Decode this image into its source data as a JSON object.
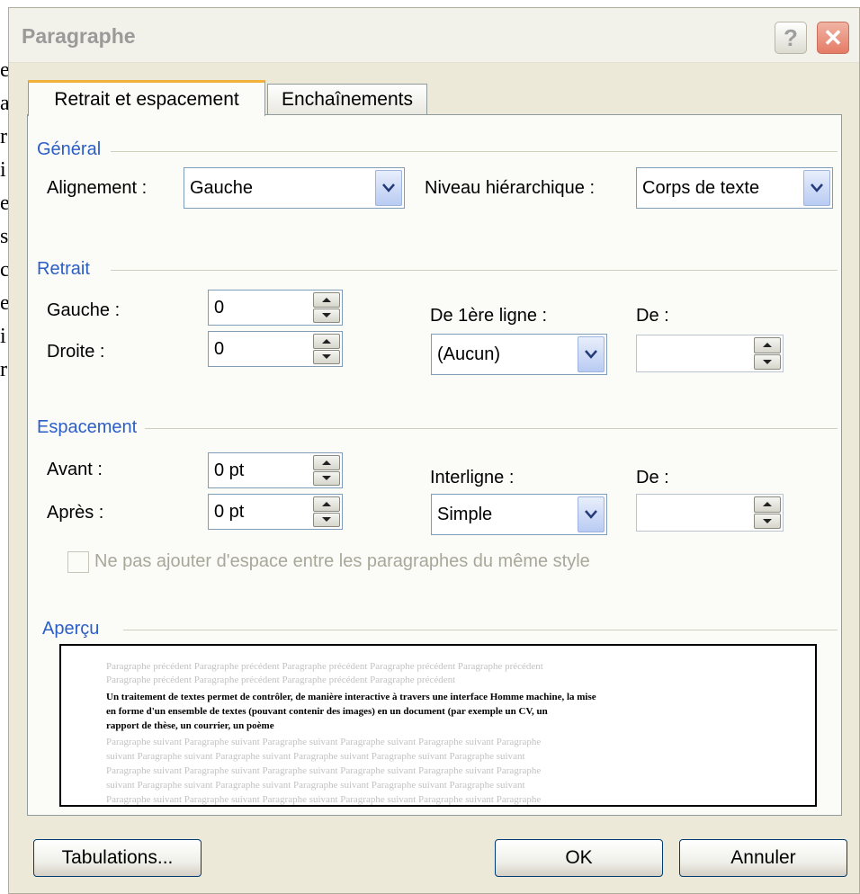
{
  "background_doc": {
    "chars": [
      "e",
      "a",
      "r",
      "i",
      "e",
      "s",
      "c",
      "e",
      "i",
      "r"
    ]
  },
  "title": "Paragraphe",
  "titlebar_buttons": {
    "help": "?",
    "close": "✕"
  },
  "tabs": [
    {
      "label": "Retrait et espacement",
      "active": true
    },
    {
      "label": "Enchaînements",
      "active": false
    }
  ],
  "general": {
    "heading": "Général",
    "alignment_label": "Alignement :",
    "alignment_value": "Gauche",
    "level_label": "Niveau hiérarchique :",
    "level_value": "Corps de texte"
  },
  "indent": {
    "heading": "Retrait",
    "left_label": "Gauche :",
    "left_value": "0",
    "right_label": "Droite :",
    "right_value": "0",
    "first_line_label": "De 1ère ligne :",
    "first_line_value": "(Aucun)",
    "by_label": "De :",
    "by_value": ""
  },
  "spacing": {
    "heading": "Espacement",
    "before_label": "Avant :",
    "before_value": "0 pt",
    "after_label": "Après :",
    "after_value": "0 pt",
    "line_label": "Interligne :",
    "line_value": "Simple",
    "at_label": "De :",
    "at_value": "",
    "no_space_checkbox_label": "Ne pas ajouter d'espace entre les paragraphes du même style",
    "no_space_checked": false
  },
  "preview": {
    "heading": "Aperçu",
    "prev_lines": [
      "Paragraphe précédent Paragraphe précédent Paragraphe précédent Paragraphe précédent Paragraphe précédent",
      "Paragraphe précédent Paragraphe précédent Paragraphe précédent Paragraphe précédent"
    ],
    "current_lines": [
      "Un traitement de textes permet de contrôler, de manière interactive à travers une interface Homme machine, la mise",
      "en forme d'un ensemble de textes (pouvant contenir des images) en un document (par exemple un CV, un",
      "rapport de thèse, un courrier, un poème"
    ],
    "next_lines": [
      "Paragraphe suivant Paragraphe suivant Paragraphe suivant Paragraphe suivant Paragraphe suivant Paragraphe",
      "suivant Paragraphe suivant Paragraphe suivant Paragraphe suivant Paragraphe suivant Paragraphe suivant",
      "Paragraphe suivant Paragraphe suivant Paragraphe suivant Paragraphe suivant Paragraphe suivant Paragraphe",
      "suivant Paragraphe suivant Paragraphe suivant Paragraphe suivant Paragraphe suivant Paragraphe suivant",
      "Paragraphe suivant Paragraphe suivant Paragraphe suivant Paragraphe suivant Paragraphe suivant Paragraphe"
    ]
  },
  "buttons": {
    "tabs_button": "Tabulations...",
    "ok": "OK",
    "cancel": "Annuler"
  },
  "colors": {
    "dialog_bg": "#ece9d8",
    "panel_bg": "#fbfbf8",
    "group_heading": "#2b5ec6",
    "active_tab_accent": "#f1b13b",
    "button_border": "#003c74"
  }
}
